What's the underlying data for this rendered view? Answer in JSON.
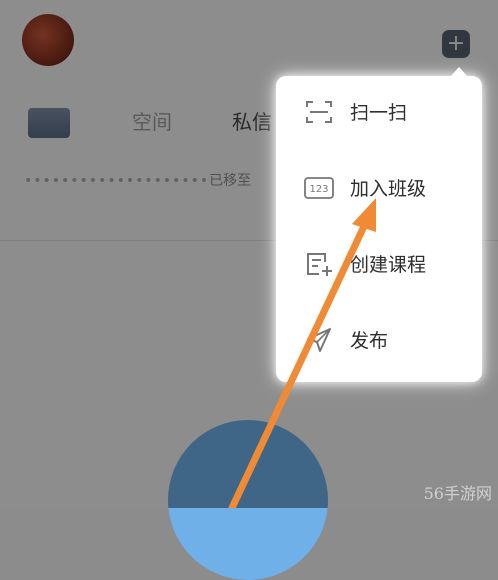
{
  "header": {
    "plus_label": "+"
  },
  "tabs": [
    {
      "label": "空间"
    },
    {
      "label": "私信"
    }
  ],
  "notice": {
    "prefix": "••••••••••••••••••••",
    "text": "已移至"
  },
  "menu": {
    "items": [
      {
        "label": "扫一扫",
        "icon": "scan-icon"
      },
      {
        "label": "加入班级",
        "icon": "join-class-icon",
        "icon_text": "123"
      },
      {
        "label": "创建课程",
        "icon": "create-course-icon"
      },
      {
        "label": "发布",
        "icon": "publish-icon"
      }
    ]
  },
  "annotation": {
    "arrow_color": "#f08a34"
  },
  "watermark": {
    "text": "56手游网"
  }
}
